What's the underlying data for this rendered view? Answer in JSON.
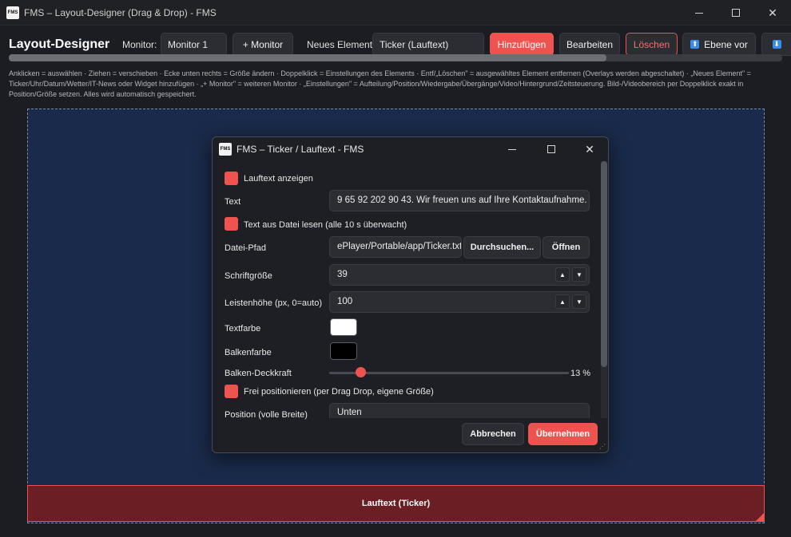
{
  "window": {
    "logo_text": "FMS",
    "title": "FMS – Layout-Designer (Drag & Drop) - FMS"
  },
  "toolbar": {
    "heading": "Layout-Designer",
    "monitor_label": "Monitor:",
    "monitor_value": "Monitor 1",
    "add_monitor_label": "+ Monitor",
    "new_element_label": "Neues Element:",
    "new_element_value": "Ticker (Lauftext)",
    "add_label": "Hinzufügen",
    "edit_label": "Bearbeiten",
    "delete_label": "Löschen",
    "layer_up_label": "Ebene vor",
    "layer_up_icon": "⬆",
    "layer_down_icon": "⬇"
  },
  "help_text": "Anklicken = auswählen · Ziehen = verschieben · Ecke unten rechts = Größe ändern · Doppelklick = Einstellungen des Elements · Entf/„Löschen\" = ausgewähltes Element entfernen (Overlays werden abgeschaltet) · „Neues Element\" = Ticker/Uhr/Datum/Wetter/IT-News oder Widget hinzufügen · „+ Monitor\" = weiteren Monitor · „Einstellungen\" = Aufteilung/Position/Wiedergabe/Übergänge/Video/Hintergrund/Zeitsteuerung. Bild-/Videobereich per Doppelklick exakt in Position/Größe setzen. Alles wird automatisch gespeichert.",
  "canvas": {
    "ticker_element_label": "Lauftext (Ticker)"
  },
  "dialog": {
    "logo_text": "FMS",
    "title": "FMS – Ticker / Lauftext - FMS",
    "show_ticker_label": "Lauftext anzeigen",
    "text_label": "Text",
    "text_value": "9 65 92 202 90 43. Wir freuen uns auf Ihre Kontaktaufnahme.",
    "read_from_file_label": "Text aus Datei lesen (alle 10 s überwacht)",
    "file_path_label": "Datei-Pfad",
    "file_path_value": "ePlayer/Portable/app/Ticker.txt",
    "browse_label": "Durchsuchen...",
    "open_label": "Öffnen",
    "font_size_label": "Schriftgröße",
    "font_size_value": "39",
    "bar_height_label": "Leistenhöhe (px, 0=auto)",
    "bar_height_value": "100",
    "text_color_label": "Textfarbe",
    "text_color": "#ffffff",
    "bar_color_label": "Balkenfarbe",
    "bar_color": "#000000",
    "opacity_label": "Balken-Deckkraft",
    "opacity_value": "13 %",
    "opacity_fraction": 0.13,
    "free_position_label": "Frei positionieren (per Drag  Drop, eigene Größe)",
    "position_label": "Position (volle Breite)",
    "position_value": "Unten",
    "cancel_label": "Abbrechen",
    "apply_label": "Übernehmen",
    "spin_up_icon": "▲",
    "spin_down_icon": "▼"
  },
  "colors": {
    "accent": "#ef5350",
    "canvas": "#1a2a4a",
    "ticker_bar": "#6b1e24"
  }
}
